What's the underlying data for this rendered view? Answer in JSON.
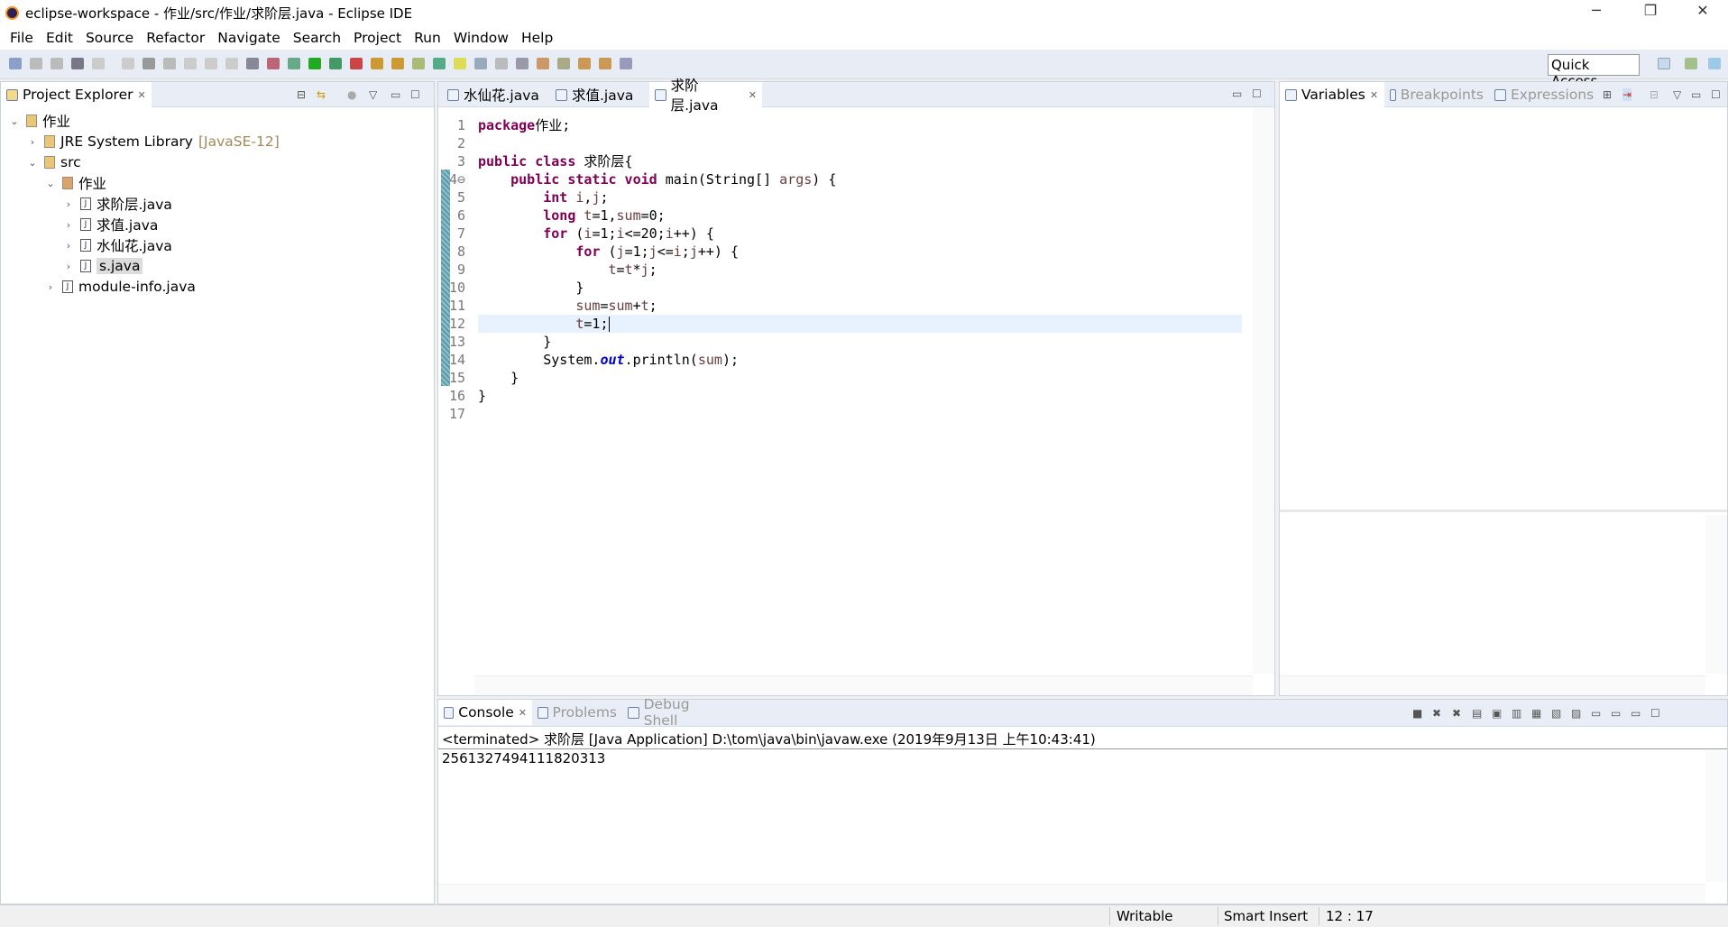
{
  "window": {
    "title": "eclipse-workspace - 作业/src/作业/求阶层.java - Eclipse IDE",
    "minimize": "─",
    "restore": "❐",
    "close": "✕"
  },
  "menu": [
    "File",
    "Edit",
    "Source",
    "Refactor",
    "Navigate",
    "Search",
    "Project",
    "Run",
    "Window",
    "Help"
  ],
  "toolbar": {
    "quick_access": "Quick Access"
  },
  "explorer": {
    "title": "Project Explorer",
    "tree": [
      {
        "label": "作业",
        "level": 0,
        "chevron": "expanded",
        "icon": "project-icon"
      },
      {
        "label": "JRE System Library",
        "suffix": "[JavaSE-12]",
        "level": 1,
        "chevron": "collapsed",
        "icon": "library-icon"
      },
      {
        "label": "src",
        "level": 1,
        "chevron": "expanded",
        "icon": "source-folder-icon"
      },
      {
        "label": "作业",
        "level": 2,
        "chevron": "expanded",
        "icon": "package-icon"
      },
      {
        "label": "求阶层.java",
        "level": 3,
        "chevron": "collapsed",
        "icon": "java-file-icon"
      },
      {
        "label": "求值.java",
        "level": 3,
        "chevron": "collapsed",
        "icon": "java-file-icon"
      },
      {
        "label": "水仙花.java",
        "level": 3,
        "chevron": "collapsed",
        "icon": "java-file-icon"
      },
      {
        "label": "s.java",
        "level": 3,
        "chevron": "collapsed",
        "icon": "java-file-icon",
        "selected": true
      },
      {
        "label": "module-info.java",
        "level": 2,
        "chevron": "collapsed",
        "icon": "java-file-icon"
      }
    ]
  },
  "editor": {
    "tabs": [
      {
        "label": "水仙花.java"
      },
      {
        "label": "求值.java"
      },
      {
        "label": "求阶层.java",
        "active": true
      }
    ],
    "current_line": 12,
    "lines": [
      [
        [
          "kw",
          "package"
        ],
        [
          "",
          "作业;"
        ]
      ],
      [],
      [
        [
          "kw",
          "public class"
        ],
        [
          "",
          " 求阶层{"
        ]
      ],
      [
        [
          "",
          "    "
        ],
        [
          "kw",
          "public static void"
        ],
        [
          "",
          " main(String[] "
        ],
        [
          "var",
          "args"
        ],
        [
          "",
          ") {"
        ]
      ],
      [
        [
          "",
          "        "
        ],
        [
          "kw",
          "int"
        ],
        [
          "var",
          " i"
        ],
        [
          "",
          ","
        ],
        [
          "var",
          "j"
        ],
        [
          "",
          ";"
        ]
      ],
      [
        [
          "",
          "        "
        ],
        [
          "kw",
          "long"
        ],
        [
          "var",
          " t"
        ],
        [
          "",
          "=1,"
        ],
        [
          "var",
          "sum"
        ],
        [
          "",
          "=0;"
        ]
      ],
      [
        [
          "",
          "        "
        ],
        [
          "kw",
          "for"
        ],
        [
          "",
          " ("
        ],
        [
          "var",
          "i"
        ],
        [
          "",
          "=1;"
        ],
        [
          "var",
          "i"
        ],
        [
          "",
          "<=20;"
        ],
        [
          "var",
          "i"
        ],
        [
          "",
          "++) {"
        ]
      ],
      [
        [
          "",
          "            "
        ],
        [
          "kw",
          "for"
        ],
        [
          "",
          " ("
        ],
        [
          "var",
          "j"
        ],
        [
          "",
          "=1;"
        ],
        [
          "var",
          "j"
        ],
        [
          "",
          "<="
        ],
        [
          "var",
          "i"
        ],
        [
          "",
          ";"
        ],
        [
          "var",
          "j"
        ],
        [
          "",
          "++) {"
        ]
      ],
      [
        [
          "",
          "                "
        ],
        [
          "var",
          "t"
        ],
        [
          "",
          "="
        ],
        [
          "var",
          "t"
        ],
        [
          "",
          "*"
        ],
        [
          "var",
          "j"
        ],
        [
          "",
          ";"
        ]
      ],
      [
        [
          "",
          "            }"
        ]
      ],
      [
        [
          "",
          "            "
        ],
        [
          "var",
          "sum"
        ],
        [
          "",
          "="
        ],
        [
          "var",
          "sum"
        ],
        [
          "",
          "+"
        ],
        [
          "var",
          "t"
        ],
        [
          "",
          ";"
        ]
      ],
      [
        [
          "",
          "            "
        ],
        [
          "var",
          "t"
        ],
        [
          "",
          "=1;"
        ]
      ],
      [
        [
          "",
          "        }"
        ]
      ],
      [
        [
          "",
          "        System."
        ],
        [
          "fld",
          "out"
        ],
        [
          "",
          ".println("
        ],
        [
          "var",
          "sum"
        ],
        [
          "",
          ");"
        ]
      ],
      [
        [
          "",
          "    }"
        ]
      ],
      [
        [
          "",
          "}"
        ]
      ],
      []
    ]
  },
  "debug_views": {
    "tabs": [
      {
        "label": "Variables",
        "active": true
      },
      {
        "label": "Breakpoints"
      },
      {
        "label": "Expressions"
      }
    ]
  },
  "console": {
    "tabs": [
      {
        "label": "Console",
        "active": true
      },
      {
        "label": "Problems"
      },
      {
        "label": "Debug Shell"
      }
    ],
    "header": "<terminated> 求阶层 [Java Application] D:\\tom\\java\\bin\\javaw.exe (2019年9月13日 上午10:43:41)",
    "output": "2561327494111820313"
  },
  "status": {
    "writable": "Writable",
    "insert_mode": "Smart Insert",
    "position": "12 : 17"
  }
}
